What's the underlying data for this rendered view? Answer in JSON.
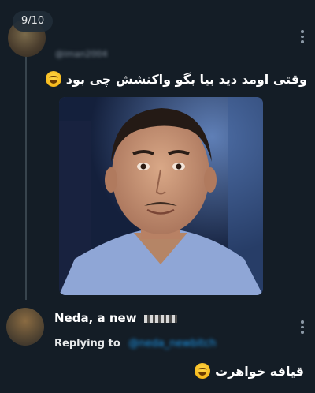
{
  "counter": "9/10",
  "tweet": {
    "handle_blurred": "@iman2004",
    "text": "وقتی اومد دید بیا بگو واکنشش چی بود",
    "emoji": "grinning-squinting-face"
  },
  "reply": {
    "author": "Neda, a new",
    "replying_label": "Replying to",
    "replying_handle_blurred": "@neda_newbitch",
    "text": "قیافه خواهرت",
    "emoji": "grinning-squinting-face"
  },
  "colors": {
    "background": "#141d26",
    "text": "#e7e9ea",
    "muted": "#8b98a5",
    "link": "#1d9bf0"
  }
}
